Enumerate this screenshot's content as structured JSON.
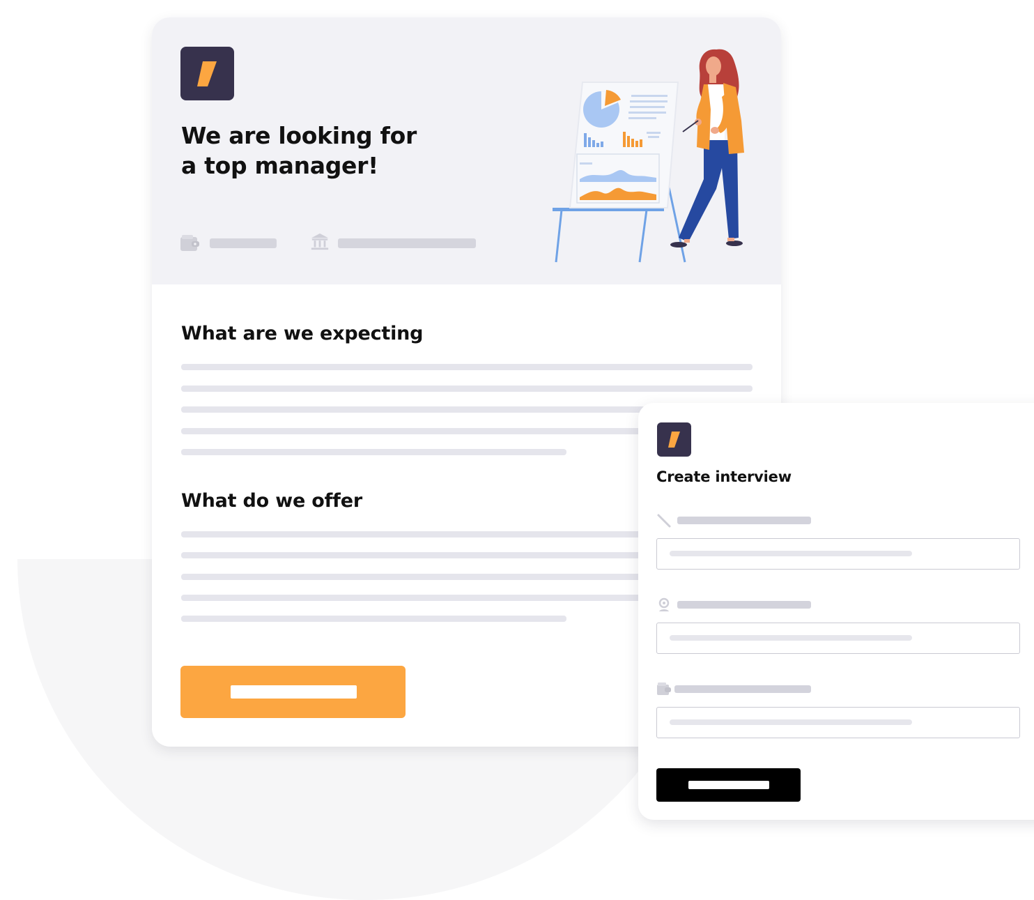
{
  "job_card": {
    "title_line1": "We are looking for",
    "title_line2": "a top manager!",
    "meta": [
      {
        "icon": "wallet-icon"
      },
      {
        "icon": "bank-icon"
      }
    ],
    "sections": [
      {
        "title": "What are we expecting"
      },
      {
        "title": "What do we offer"
      }
    ],
    "apply_button_icon": "placeholder-label-bar",
    "illustration": "woman-presenting-charts-on-easel"
  },
  "interview_card": {
    "title": "Create interview",
    "fields": [
      {
        "icon": "pencil-icon"
      },
      {
        "icon": "location-pin-icon"
      },
      {
        "icon": "wallet-icon"
      }
    ]
  },
  "colors": {
    "brand_dark": "#37324d",
    "accent_orange": "#fca641",
    "header_bg": "#f2f2f6",
    "placeholder_gray": "#e5e5ec",
    "create_button": "#000000"
  }
}
